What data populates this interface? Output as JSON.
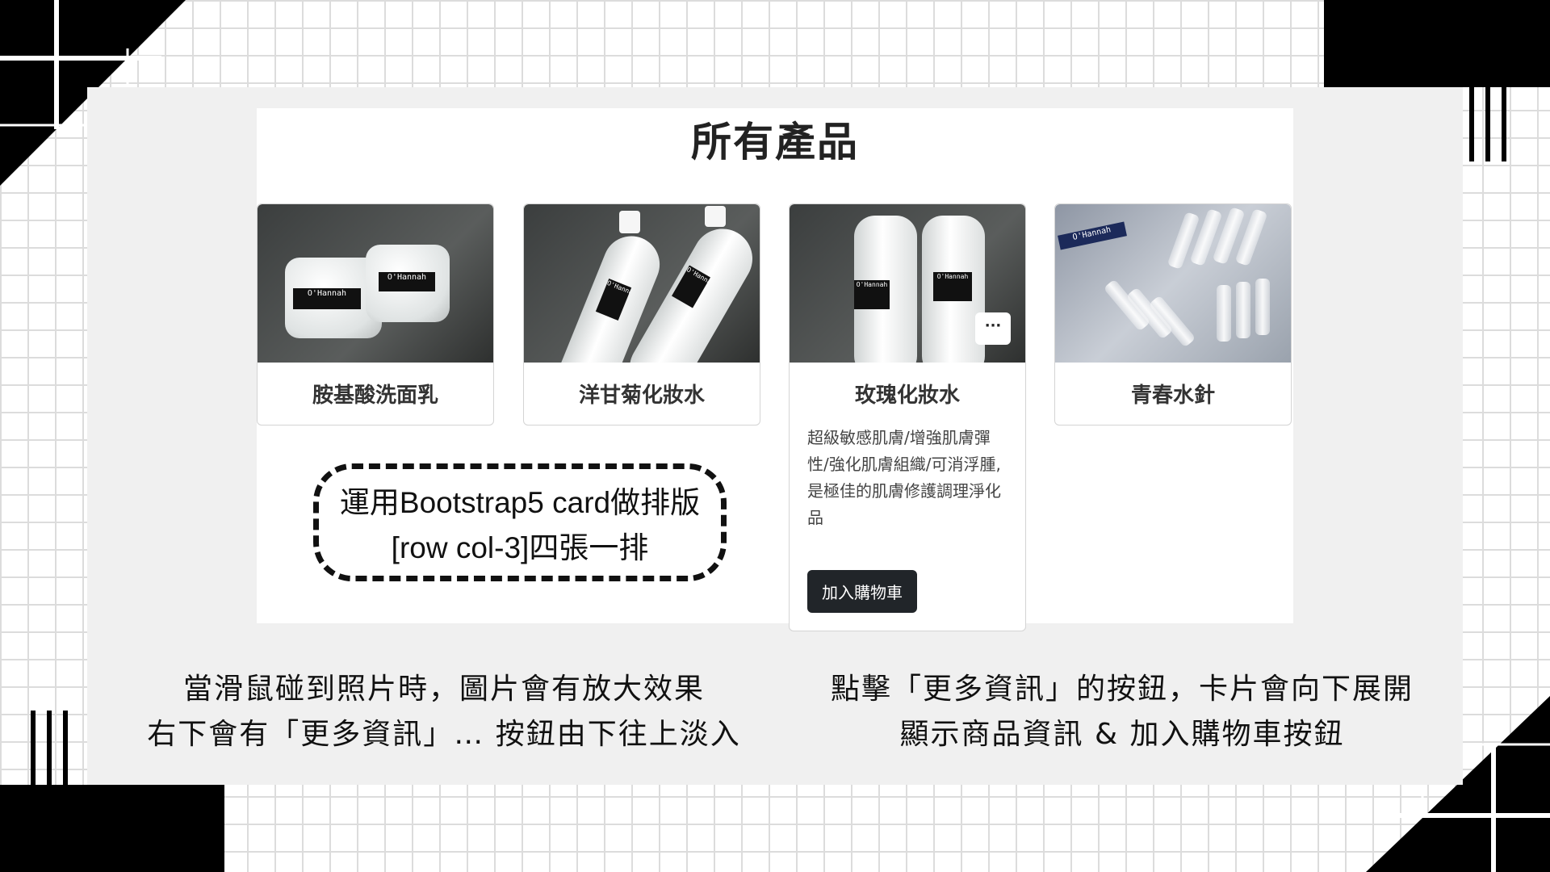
{
  "page": {
    "title": "所有產品",
    "annotation": {
      "line1": "運用Bootstrap5 card做排版",
      "line2": "[row col-3]四張一排"
    },
    "captions": {
      "left_line1": "當滑鼠碰到照片時，圖片會有放大效果",
      "left_line2": "右下會有「更多資訊」… 按鈕由下往上淡入",
      "right_line1": "點擊「更多資訊」的按鈕，卡片會向下展開",
      "right_line2": "顯示商品資訊 & 加入購物車按鈕"
    }
  },
  "products": [
    {
      "name": "胺基酸洗面乳"
    },
    {
      "name": "洋甘菊化妝水"
    },
    {
      "name": "玫瑰化妝水",
      "description": "超級敏感肌膚/增強肌膚彈性/強化肌膚組織/可消浮腫,是極佳的肌膚修護調理淨化品",
      "more_label": "···",
      "cart_label": "加入購物車"
    },
    {
      "name": "青春水針"
    }
  ],
  "brand_label": "O'Hannah",
  "colors": {
    "panel": "#f0f0f0",
    "button_dark": "#212529",
    "grid": "#dcdcdc"
  }
}
